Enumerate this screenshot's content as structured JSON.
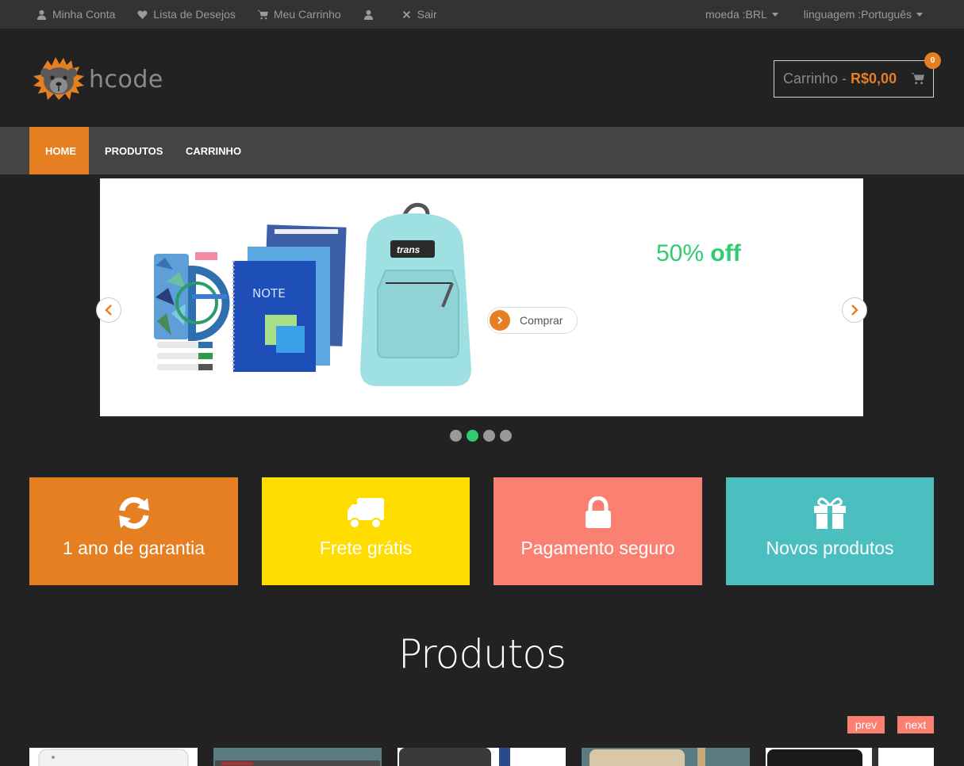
{
  "topbar": {
    "links": [
      {
        "label": "Minha Conta",
        "icon": "user-icon"
      },
      {
        "label": "Lista de Desejos",
        "icon": "heart-icon"
      },
      {
        "label": "Meu Carrinho",
        "icon": "cart-icon"
      },
      {
        "label": "",
        "icon": "user-icon"
      },
      {
        "label": "Sair",
        "icon": "close-icon"
      }
    ],
    "currency": "moeda :BRL",
    "language": "linguagem :Português"
  },
  "header": {
    "logo_text": "hcode",
    "cart_label": "Carrinho -",
    "cart_amount": "R$0,00",
    "cart_count": "0"
  },
  "nav": {
    "items": [
      "HOME",
      "PRODUTOS",
      "CARRINHO"
    ],
    "active": "HOME"
  },
  "slider": {
    "discount_number": "50%",
    "discount_word": "off",
    "button_label": "Comprar",
    "slide_count": 4,
    "active_slide": 2
  },
  "features": [
    {
      "label": "1 ano de garantia",
      "icon": "refresh-icon",
      "color": "#e67e22"
    },
    {
      "label": "Frete grátis",
      "icon": "truck-icon",
      "color": "#ffdd00"
    },
    {
      "label": "Pagamento seguro",
      "icon": "lock-icon",
      "color": "#fa8072"
    },
    {
      "label": "Novos produtos",
      "icon": "gift-icon",
      "color": "#4bbfbf"
    }
  ],
  "products": {
    "title": "Produtos",
    "prev_label": "prev",
    "next_label": "next"
  },
  "colors": {
    "accent": "#e67e22",
    "green": "#2ecc71",
    "salmon": "#fa8072"
  }
}
